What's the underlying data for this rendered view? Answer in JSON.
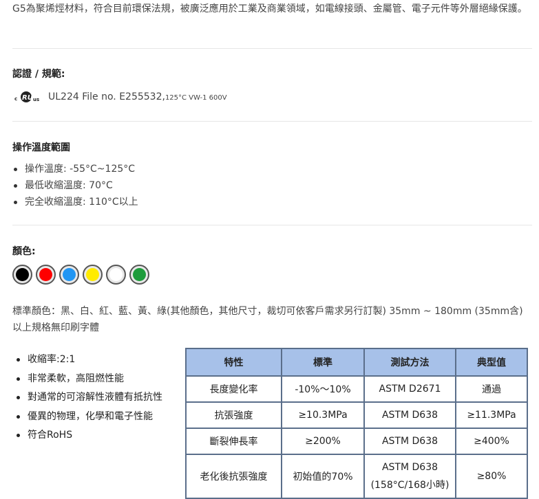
{
  "intro": "G5為聚烯烴材料，符合目前環保法規，被廣泛應用於工業及商業領域，如電線接頭、金屬管、電子元件等外層絕緣保護。",
  "certification": {
    "heading": "認證 / 規範:",
    "ul_logo": "cULus",
    "text": "UL224 File no. E255532,",
    "small": "125°C VW-1 600V"
  },
  "temperature": {
    "heading": "操作溫度範圍",
    "items": [
      "操作溫度: -55°C~125°C",
      "最低收縮溫度: 70°C",
      "完全收縮溫度: 110°C以上"
    ]
  },
  "colors": {
    "heading": "顏色:",
    "swatches": [
      "#000000",
      "#ff0000",
      "#2196f3",
      "#ffeb00",
      "#ffffff",
      "#1e9c3c"
    ],
    "standard_text": "標準顏色：黑、白、紅、藍、黃、綠(其他顏色，其他尺寸，裁切可依客戶需求另行訂製) 35mm ~ 180mm (35mm含)以上規格無印刷字體"
  },
  "features": [
    "收縮率:2:1",
    "非常柔軟，高阻燃性能",
    "對通常的可溶解性液體有抵抗性",
    "優異的物理，化學和電子性能",
    "符合RoHS"
  ],
  "spec_table": {
    "headers": [
      "特性",
      "標準",
      "測試方法",
      "典型值"
    ],
    "rows": [
      [
        "長度變化率",
        "-10%～10%",
        "ASTM D2671",
        "通過"
      ],
      [
        "抗張強度",
        "≥10.3MPa",
        "ASTM D638",
        "≥11.3MPa"
      ],
      [
        "斷裂伸長率",
        "≥200%",
        "ASTM D638",
        "≥400%"
      ],
      [
        "老化後抗張強度",
        "初始值的70%",
        "ASTM D638",
        "≥80%"
      ]
    ],
    "row4_method_note": "(158°C/168小時)"
  }
}
